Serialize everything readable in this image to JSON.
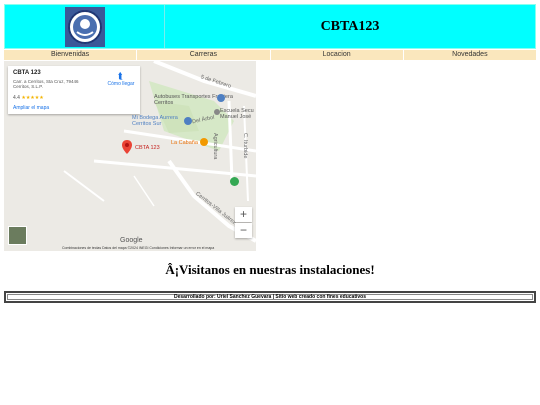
{
  "header": {
    "title": "CBTA123",
    "logo_icon": "school-seal-icon"
  },
  "nav": [
    {
      "label": "Bienvenidas"
    },
    {
      "label": "Carreras"
    },
    {
      "label": "Locacion"
    },
    {
      "label": "Novedades"
    }
  ],
  "map": {
    "place_name": "CBTA 123",
    "address": "Carr. a Cerritos, Sta Cruz, 79446 Cerritos, S.L.P.",
    "rating": "4.4",
    "stars": "★★★★★",
    "enlarge_link": "Ampliar el mapa",
    "directions_label": "Cómo llegar",
    "labels": {
      "pin": "CBTA 123",
      "bus": "Autobuses Transportes Frontera Cerritos",
      "bodega": "Mi Bodega Aurrera Cerritos Sur",
      "school": "Escuela Secu Manuel José",
      "cabana": "La Cabaña",
      "febrero": "5 de Febrero",
      "agricultura": "Agricultura",
      "iturbide": "C. Iturbide",
      "del_arbol": "Del Árbol",
      "villa_juarez": "Cerritos-Villa Juárez"
    },
    "zoom_in": "+",
    "zoom_out": "−",
    "google": "Google",
    "footer_links": "Combinaciones de teclas   Datos del mapa ©2024 INEGI   Condiciones   Informar un error en el mapa"
  },
  "tagline": "Â¡Visitanos en nuestras instalaciones!",
  "credits": "Desarrollado por: Uriel Sanchez Guevara | Sitio web creado con fines educativos"
}
